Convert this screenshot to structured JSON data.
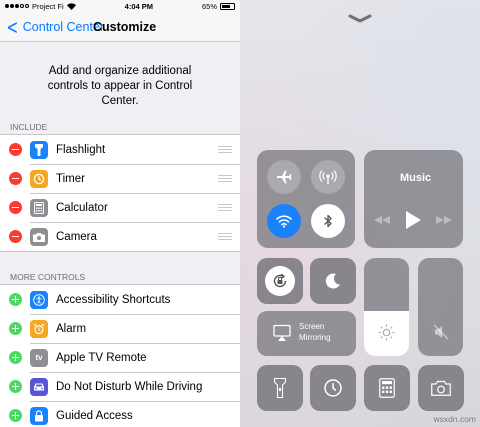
{
  "status_bar": {
    "carrier": "Project Fi",
    "time": "4:04 PM",
    "battery": "65%"
  },
  "nav": {
    "back_label": "Control Center",
    "title": "Customize"
  },
  "description": "Add and organize additional controls to appear in Control Center.",
  "include": {
    "header": "INCLUDE",
    "items": [
      {
        "label": "Flashlight",
        "icon": "flashlight-icon",
        "color": "#1a82fb"
      },
      {
        "label": "Timer",
        "icon": "timer-icon",
        "color": "#f5a623"
      },
      {
        "label": "Calculator",
        "icon": "calculator-icon",
        "color": "#8e8e93"
      },
      {
        "label": "Camera",
        "icon": "camera-icon",
        "color": "#8e8e93"
      }
    ]
  },
  "more": {
    "header": "MORE CONTROLS",
    "items": [
      {
        "label": "Accessibility Shortcuts",
        "icon": "accessibility-icon",
        "color": "#1a82fb"
      },
      {
        "label": "Alarm",
        "icon": "alarm-icon",
        "color": "#f5a623"
      },
      {
        "label": "Apple TV Remote",
        "icon": "apple-tv-icon",
        "icon_text": "tv",
        "color": "#8e8e93"
      },
      {
        "label": "Do Not Disturb While Driving",
        "icon": "car-icon",
        "color": "#5856d6"
      },
      {
        "label": "Guided Access",
        "icon": "lock-icon",
        "color": "#1a82fb"
      }
    ]
  },
  "control_center": {
    "music_label": "Music",
    "screen_mirroring_label": "Screen Mirroring",
    "connectivity": [
      "airplane-mode",
      "cellular-data",
      "wifi",
      "bluetooth"
    ],
    "wifi_color": "#1a82fb"
  },
  "watermark": "wsxdn.com"
}
